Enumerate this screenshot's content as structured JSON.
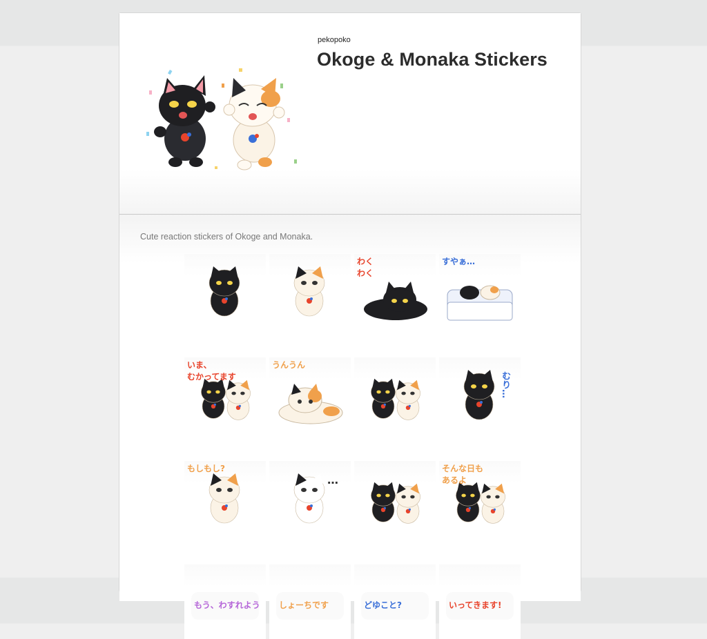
{
  "header": {
    "creator": "pekopoko",
    "title": "Okoge & Monaka Stickers"
  },
  "description": "Cute reaction stickers of Okoge and Monaka.",
  "colors": {
    "black_cat": "#1f1f22",
    "calico_orange": "#f0a04b",
    "cream": "#fbf3e6",
    "accent_red": "#e8442c",
    "accent_blue": "#3a6fd8",
    "accent_pink": "#ff7eb6"
  },
  "stickers": [
    {
      "name": "black-cat-angry",
      "caption": ""
    },
    {
      "name": "calico-cat-crying",
      "caption": ""
    },
    {
      "name": "black-cat-lying-excited",
      "caption": "わく\nわく"
    },
    {
      "name": "cats-sleeping",
      "caption": "すやぁ…"
    },
    {
      "name": "cats-running",
      "caption": "いま、\nむかってます"
    },
    {
      "name": "calico-cat-lying",
      "caption": "うんうん"
    },
    {
      "name": "cats-cheering",
      "caption": ""
    },
    {
      "name": "black-cat-refusing",
      "caption": "むり…"
    },
    {
      "name": "calico-cat-phone",
      "caption": "もしもし?"
    },
    {
      "name": "calico-cat-shocked",
      "caption": "…"
    },
    {
      "name": "cats-love",
      "caption": ""
    },
    {
      "name": "cats-comfort",
      "caption": "そんな日も\nあるよ"
    },
    {
      "name": "sticker-forgot",
      "caption": "もう、わすれよう"
    },
    {
      "name": "sticker-shoganai",
      "caption": "しょーちです"
    },
    {
      "name": "sticker-what",
      "caption": "どゆこと?"
    },
    {
      "name": "sticker-going",
      "caption": "いってきます!"
    }
  ]
}
